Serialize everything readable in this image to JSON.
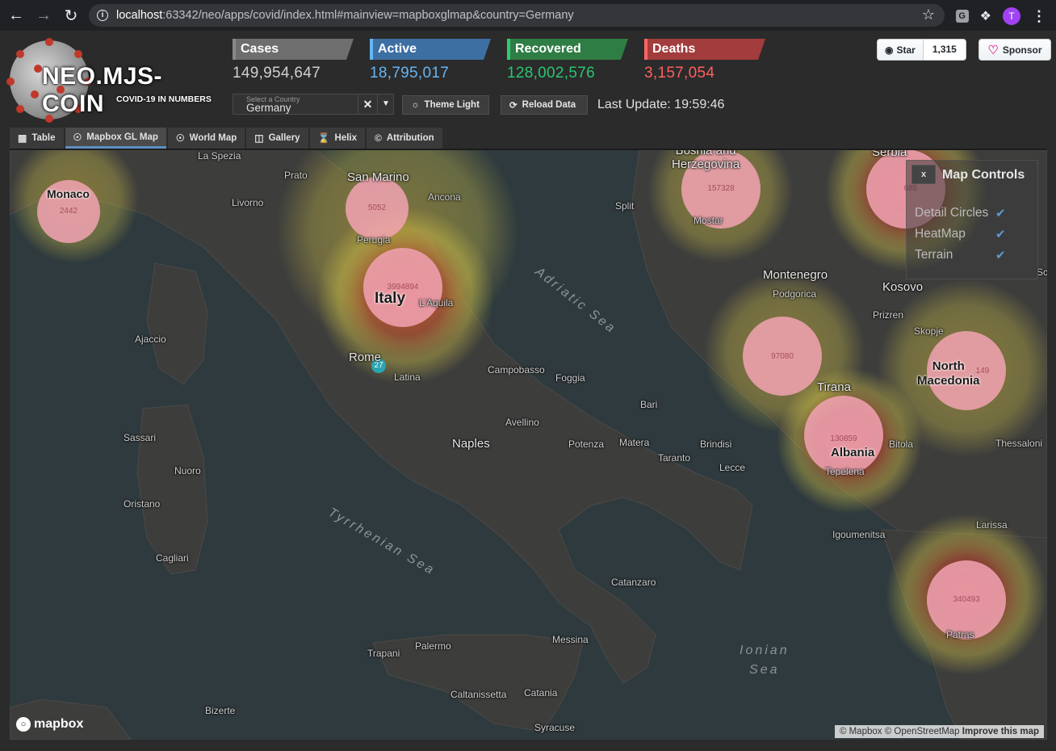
{
  "browser": {
    "url_host": "localhost",
    "url_rest": ":63342/neo/apps/covid/index.html#mainview=mapboxglmap&country=Germany",
    "avatar_letter": "T",
    "ext_letter": "G"
  },
  "logo": {
    "title": "NEO.MJS-COIN",
    "subtitle": "COVID-19 IN NUMBERS"
  },
  "stats": {
    "cases": {
      "label": "Cases",
      "value": "149,954,647"
    },
    "active": {
      "label": "Active",
      "value": "18,795,017"
    },
    "recovered": {
      "label": "Recovered",
      "value": "128,002,576"
    },
    "deaths": {
      "label": "Deaths",
      "value": "3,157,054"
    }
  },
  "country_select": {
    "placeholder": "Select a Country",
    "value": "Germany",
    "clear": "✕",
    "trigger": "▼"
  },
  "buttons": {
    "theme": "Theme Light",
    "reload": "Reload Data"
  },
  "last_update": "Last Update: 19:59:46",
  "github": {
    "star": "Star",
    "count": "1,315",
    "sponsor": "Sponsor"
  },
  "tabs": [
    {
      "label": "Table",
      "icon": "table-icon"
    },
    {
      "label": "Mapbox GL Map",
      "icon": "globe-icon"
    },
    {
      "label": "World Map",
      "icon": "globe-icon"
    },
    {
      "label": "Gallery",
      "icon": "images-icon"
    },
    {
      "label": "Helix",
      "icon": "hourglass-icon"
    },
    {
      "label": "Attribution",
      "icon": "copyright-icon"
    }
  ],
  "active_tab": "Mapbox GL Map",
  "map_controls": {
    "title": "Map Controls",
    "close": "x",
    "items": [
      {
        "label": "Detail Circles",
        "checked": true
      },
      {
        "label": "HeatMap",
        "checked": true
      },
      {
        "label": "Terrain",
        "checked": true
      }
    ]
  },
  "map": {
    "places": {
      "la_spezia": "La Spezia",
      "prato": "Prato",
      "livorno": "Livorno",
      "san_marino": "San Marino",
      "ancona": "Ancona",
      "perugia": "Perugia",
      "laquila": "L'Aquila",
      "rome": "Rome",
      "latina": "Latina",
      "campobasso": "Campobasso",
      "foggia": "Foggia",
      "bari": "Bari",
      "avellino": "Avellino",
      "naples": "Naples",
      "potenza": "Potenza",
      "matera": "Matera",
      "brindisi": "Brindisi",
      "taranto": "Taranto",
      "lecce": "Lecce",
      "catanzaro": "Catanzaro",
      "messina": "Messina",
      "palermo": "Palermo",
      "trapani": "Trapani",
      "caltanissetta": "Caltanissetta",
      "catania": "Catania",
      "syracuse": "Syracuse",
      "bizerte": "Bizerte",
      "ajaccio": "Ajaccio",
      "sassari": "Sassari",
      "nuoro": "Nuoro",
      "oristano": "Oristano",
      "cagliari": "Cagliari",
      "split": "Split",
      "mostar": "Mostar",
      "podgorica": "Podgorica",
      "montenegro": "Montenegro",
      "kosovo": "Kosovo",
      "prizren": "Prizren",
      "skopje": "Skopje",
      "tirana": "Tirana",
      "tepelena": "Tepelena",
      "bitola": "Bitola",
      "thessaloniki": "Thessaloni",
      "igoumenitsa": "Igoumenitsa",
      "larissa": "Larissa",
      "patras": "Patras",
      "serbia": "Serbia",
      "bosnia": "Bosnia and\nHerzegovina",
      "sc": "Sc"
    },
    "countries": {
      "monaco": "Monaco",
      "italy": "Italy",
      "albania": "Albania",
      "north_macedonia": "North\nMacedonia"
    },
    "seas": {
      "adriatic": "Adriatic Sea",
      "tyrrhenian": "Tyrrhenian Sea",
      "ionian": "Ionian\nSea"
    },
    "circle_values": {
      "monaco": "2442",
      "san_marino": "5052",
      "italy": "3994894",
      "bosnia": "157328",
      "serbia": "685",
      "montenegro": "97080",
      "albania": "130859",
      "north_macedonia": "149",
      "greece": "340493",
      "vatican": "27"
    },
    "heat_color": "#e8d94a",
    "circle_color": "#f2a3b3",
    "mapbox_label": "mapbox",
    "attribution": "© Mapbox © OpenStreetMap",
    "improve": "Improve this map"
  }
}
